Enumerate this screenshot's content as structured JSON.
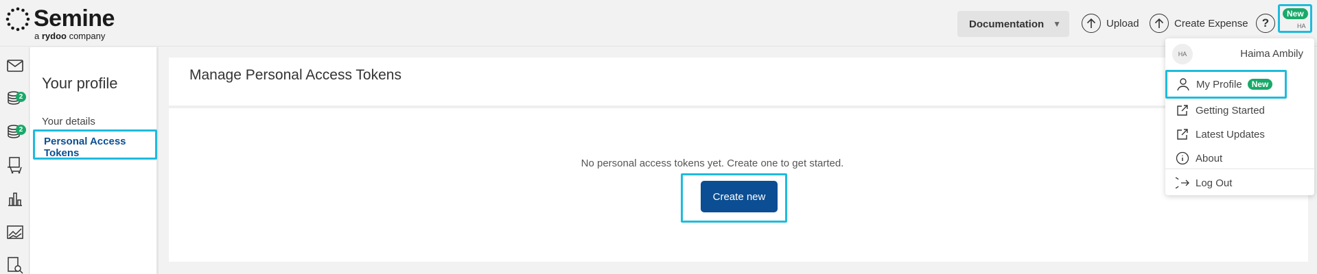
{
  "brand": {
    "name": "Semine",
    "sub_prefix": "a ",
    "sub_brand": "rydoo",
    "sub_suffix": " company"
  },
  "topbar": {
    "documentation_label": "Documentation",
    "upload_label": "Upload",
    "create_expense_label": "Create Expense",
    "help_label": "?",
    "avatar_initials": "HA",
    "avatar_badge": "New"
  },
  "leftnav": {
    "icons": [
      "mail-icon",
      "coins-icon",
      "coins-icon",
      "receipt-cart-icon",
      "bar-chart-icon",
      "trend-chart-icon",
      "search-report-icon"
    ],
    "badge_1": "2",
    "badge_2": "2"
  },
  "profile_nav": {
    "title": "Your profile",
    "items": [
      "Your details",
      "Personal Access Tokens"
    ],
    "active": "Personal Access Tokens"
  },
  "main": {
    "title": "Manage Personal Access Tokens",
    "empty_message": "No personal access tokens yet. Create one to get started.",
    "create_label": "Create new"
  },
  "user_menu": {
    "avatar_initials": "HA",
    "user_name": "Haima Ambily",
    "my_profile_label": "My Profile",
    "my_profile_badge": "New",
    "getting_started_label": "Getting Started",
    "latest_updates_label": "Latest Updates",
    "about_label": "About",
    "logout_label": "Log Out"
  },
  "colors": {
    "accent_blue": "#0b4e93",
    "highlight_cyan": "#1ebbdc",
    "badge_green": "#1aa96a"
  }
}
